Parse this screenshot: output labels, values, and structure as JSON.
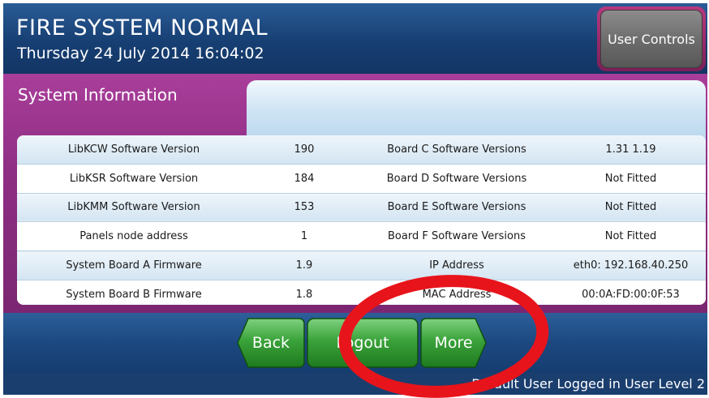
{
  "header": {
    "status_title": "FIRE SYSTEM NORMAL",
    "datetime": "Thursday 24 July 2014 16:04:02",
    "user_controls_label": "User Controls"
  },
  "panel": {
    "tab_label": "System Information"
  },
  "table": {
    "rows": [
      {
        "label_left": "LibKCW Software Version",
        "value_left": "190",
        "label_right": "Board C Software Versions",
        "value_right": "1.31 1.19"
      },
      {
        "label_left": "LibKSR Software Version",
        "value_left": "184",
        "label_right": "Board D Software Versions",
        "value_right": "Not Fitted"
      },
      {
        "label_left": "LibKMM Software Version",
        "value_left": "153",
        "label_right": "Board E Software Versions",
        "value_right": "Not Fitted"
      },
      {
        "label_left": "Panels node address",
        "value_left": "1",
        "label_right": "Board F Software Versions",
        "value_right": "Not Fitted"
      },
      {
        "label_left": "System Board A Firmware",
        "value_left": "1.9",
        "label_right": "IP Address",
        "value_right": "eth0: 192.168.40.250"
      },
      {
        "label_left": "System Board B Firmware",
        "value_left": "1.8",
        "label_right": "MAC Address",
        "value_right": "00:0A:FD:00:0F:53"
      }
    ]
  },
  "footer": {
    "back_label": "Back",
    "logout_label": "Logout",
    "more_label": "More"
  },
  "statusbar": {
    "text": "Default User Logged in User Level 2"
  },
  "colors": {
    "header_blue": "#173f73",
    "panel_purple": "#8f2e84",
    "button_green": "#2f9a2f",
    "annotation_red": "#e8141b"
  }
}
